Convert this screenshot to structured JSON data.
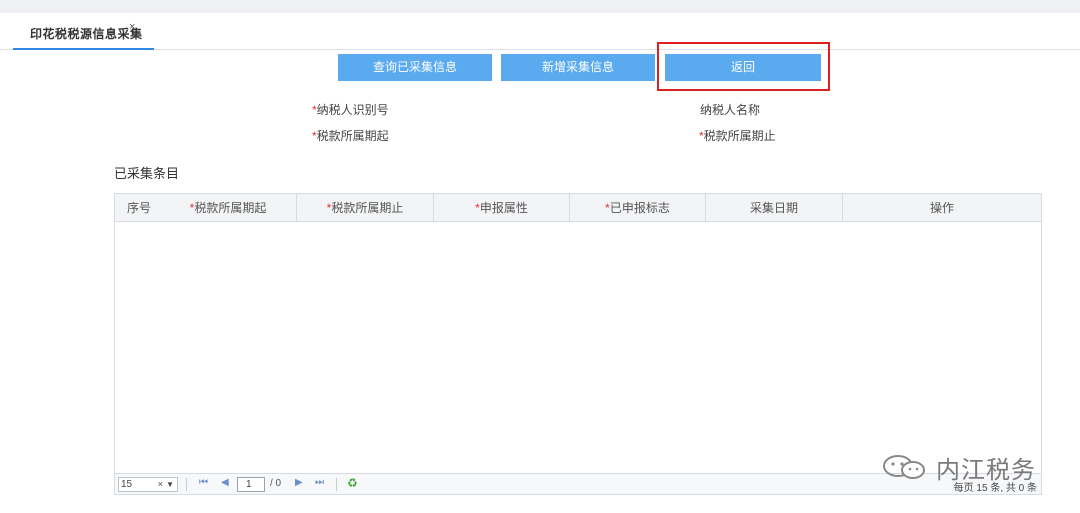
{
  "tab": {
    "label": "印花税税源信息采集",
    "close": "×"
  },
  "toolbar": {
    "query_label": "查询已采集信息",
    "add_label": "新增采集信息",
    "back_label": "返回"
  },
  "form": {
    "taxpayer_id_label": "纳税人识别号",
    "taxpayer_name_label": "纳税人名称",
    "period_start_label": "税款所属期起",
    "period_end_label": "税款所属期止",
    "required_mark": "*"
  },
  "section": {
    "title": "已采集条目"
  },
  "table": {
    "columns": [
      {
        "label": "序号",
        "required": false
      },
      {
        "label": "税款所属期起",
        "required": true
      },
      {
        "label": "税款所属期止",
        "required": true
      },
      {
        "label": "申报属性",
        "required": true
      },
      {
        "label": "已申报标志",
        "required": true
      },
      {
        "label": "采集日期",
        "required": false
      },
      {
        "label": "操作",
        "required": false
      }
    ],
    "rows": []
  },
  "pager": {
    "page_size": "15",
    "clear": "×",
    "dropdown": "▼",
    "first": "⏮",
    "prev": "◀",
    "current_page": "1",
    "total_pages": "/ 0",
    "next": "▶",
    "last": "⏭",
    "refresh": "♻",
    "info": "每页 15 条, 共 0 条"
  },
  "watermark": {
    "text": "内江税务"
  },
  "colors": {
    "button": "#5aaaf0",
    "highlight": "#e02020",
    "required": "#e53030",
    "tab_underline": "#2a8ae6"
  }
}
